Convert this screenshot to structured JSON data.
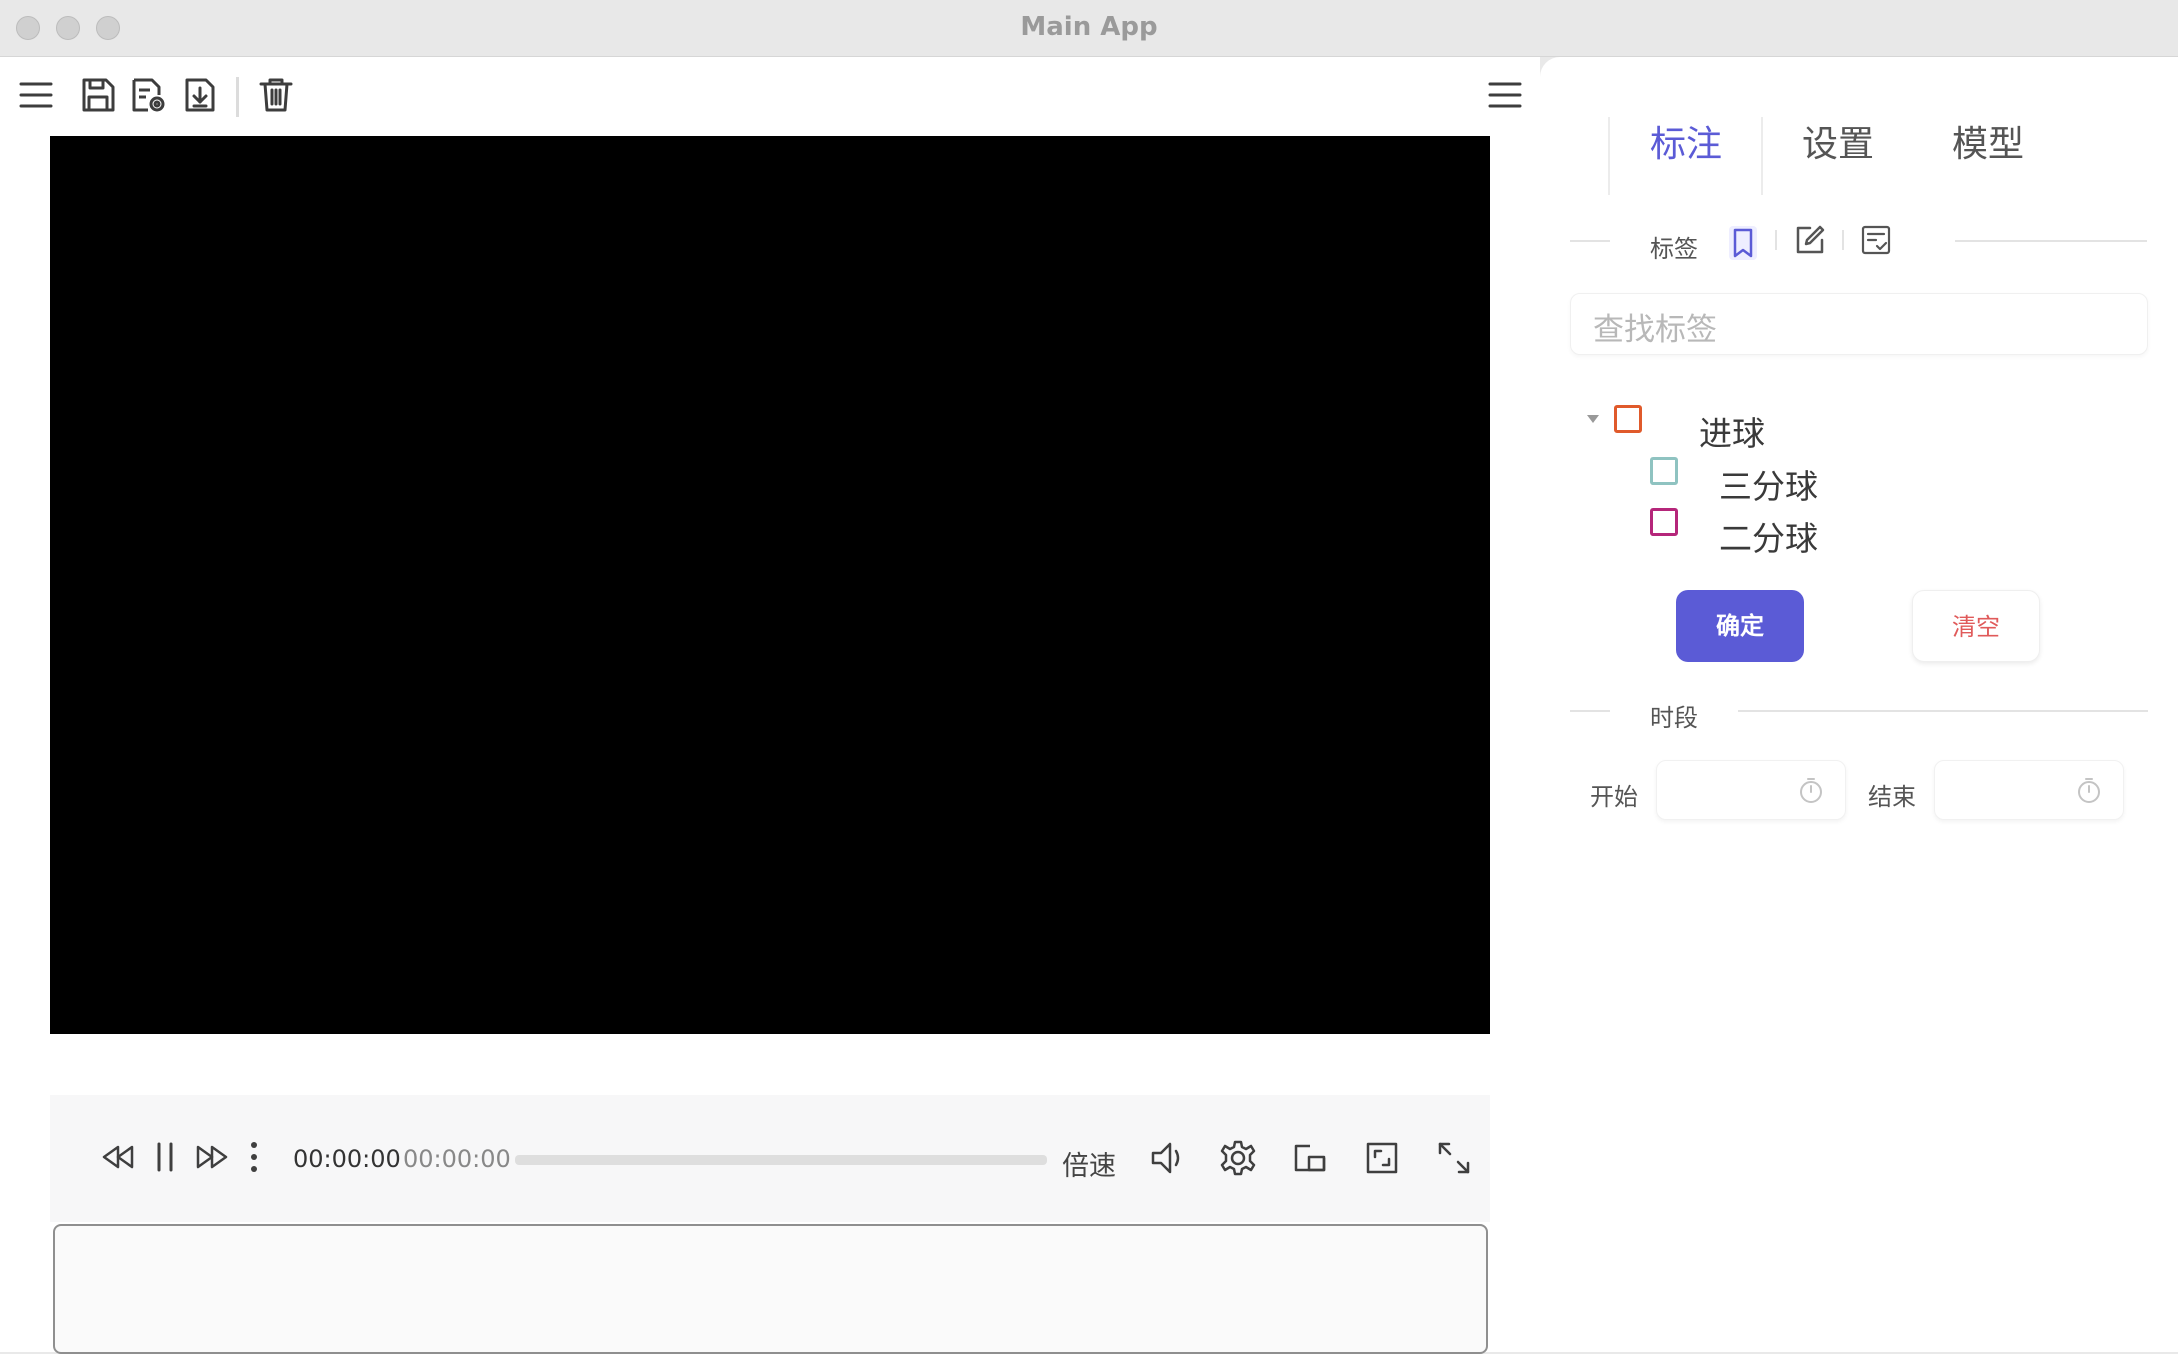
{
  "window": {
    "title": "Main App"
  },
  "toolbar": {
    "icons": [
      "menu-icon",
      "save-icon",
      "save-settings-icon",
      "import-icon",
      "trash-icon",
      "menu-icon"
    ]
  },
  "player": {
    "current_time": "00:00:00",
    "total_time": "00:00:00",
    "progress": 0,
    "speed_label": "倍速"
  },
  "panel": {
    "tabs": [
      {
        "label": "标注",
        "active": true
      },
      {
        "label": "设置",
        "active": false
      },
      {
        "label": "模型",
        "active": false
      }
    ],
    "labels_section": {
      "title": "标签",
      "search_placeholder": "查找标签"
    },
    "tree": {
      "parent": {
        "label": "进球",
        "color": "#e05a2b",
        "expanded": true
      },
      "children": [
        {
          "label": "三分球",
          "color": "#8fc3c1"
        },
        {
          "label": "二分球",
          "color": "#b5267a"
        }
      ]
    },
    "buttons": {
      "confirm": "确定",
      "clear": "清空"
    },
    "period_section": {
      "title": "时段",
      "start_label": "开始",
      "end_label": "结束"
    }
  },
  "colors": {
    "accent": "#5b5bd6",
    "danger": "#e05a5a"
  }
}
